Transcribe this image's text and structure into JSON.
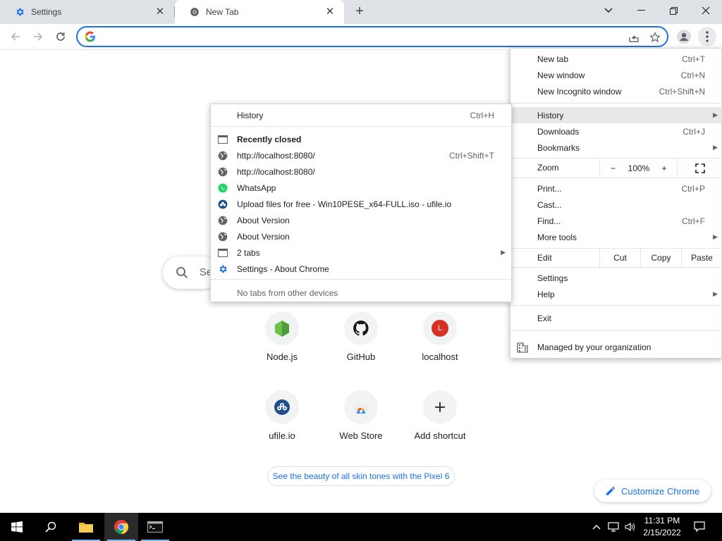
{
  "tabs": [
    {
      "title": "Settings",
      "icon": "gear-icon"
    },
    {
      "title": "New Tab",
      "icon": "chrome-icon"
    }
  ],
  "omnibox": {
    "value": "",
    "placeholder": ""
  },
  "search": {
    "placeholder": "Se"
  },
  "shortcuts": [
    {
      "label": "Node.js",
      "icon": "nodejs-icon"
    },
    {
      "label": "GitHub",
      "icon": "github-icon"
    },
    {
      "label": "localhost",
      "icon": "localhost-icon",
      "letter": "L"
    },
    {
      "label": "ufile.io",
      "icon": "ufile-icon"
    },
    {
      "label": "Web Store",
      "icon": "webstore-icon"
    },
    {
      "label": "Add shortcut",
      "icon": "plus-icon"
    }
  ],
  "promo": "See the beauty of all skin tones with the Pixel 6",
  "customize": "Customize Chrome",
  "main_menu": {
    "new_tab": {
      "label": "New tab",
      "shortcut": "Ctrl+T"
    },
    "new_window": {
      "label": "New window",
      "shortcut": "Ctrl+N"
    },
    "new_incognito": {
      "label": "New Incognito window",
      "shortcut": "Ctrl+Shift+N"
    },
    "history": {
      "label": "History"
    },
    "downloads": {
      "label": "Downloads",
      "shortcut": "Ctrl+J"
    },
    "bookmarks": {
      "label": "Bookmarks"
    },
    "zoom": {
      "label": "Zoom",
      "minus": "−",
      "value": "100%",
      "plus": "+"
    },
    "print": {
      "label": "Print...",
      "shortcut": "Ctrl+P"
    },
    "cast": {
      "label": "Cast..."
    },
    "find": {
      "label": "Find...",
      "shortcut": "Ctrl+F"
    },
    "more_tools": {
      "label": "More tools"
    },
    "edit": {
      "label": "Edit",
      "cut": "Cut",
      "copy": "Copy",
      "paste": "Paste"
    },
    "settings": {
      "label": "Settings"
    },
    "help": {
      "label": "Help"
    },
    "exit": {
      "label": "Exit"
    },
    "managed": {
      "label": "Managed by your organization"
    }
  },
  "history_menu": {
    "history": {
      "label": "History",
      "shortcut": "Ctrl+H"
    },
    "recently_closed": "Recently closed",
    "items": [
      {
        "label": "http://localhost:8080/",
        "shortcut": "Ctrl+Shift+T",
        "icon": "globe-icon"
      },
      {
        "label": "http://localhost:8080/",
        "shortcut": "",
        "icon": "globe-icon"
      },
      {
        "label": "WhatsApp",
        "shortcut": "",
        "icon": "whatsapp-icon"
      },
      {
        "label": "Upload files for free - Win10PESE_x64-FULL.iso - ufile.io",
        "shortcut": "",
        "icon": "ufile-icon"
      },
      {
        "label": "About Version",
        "shortcut": "",
        "icon": "globe-icon"
      },
      {
        "label": "About Version",
        "shortcut": "",
        "icon": "globe-icon"
      },
      {
        "label": "2 tabs",
        "shortcut": "",
        "icon": "window-icon"
      },
      {
        "label": "Settings - About Chrome",
        "shortcut": "",
        "icon": "gear-icon"
      }
    ],
    "no_tabs": "No tabs from other devices"
  },
  "taskbar": {
    "time": "11:31 PM",
    "date": "2/15/2022"
  },
  "colors": {
    "accent": "#1a73e8",
    "tabstrip": "#dee1e6",
    "menu_highlight": "#e8e8e9"
  }
}
